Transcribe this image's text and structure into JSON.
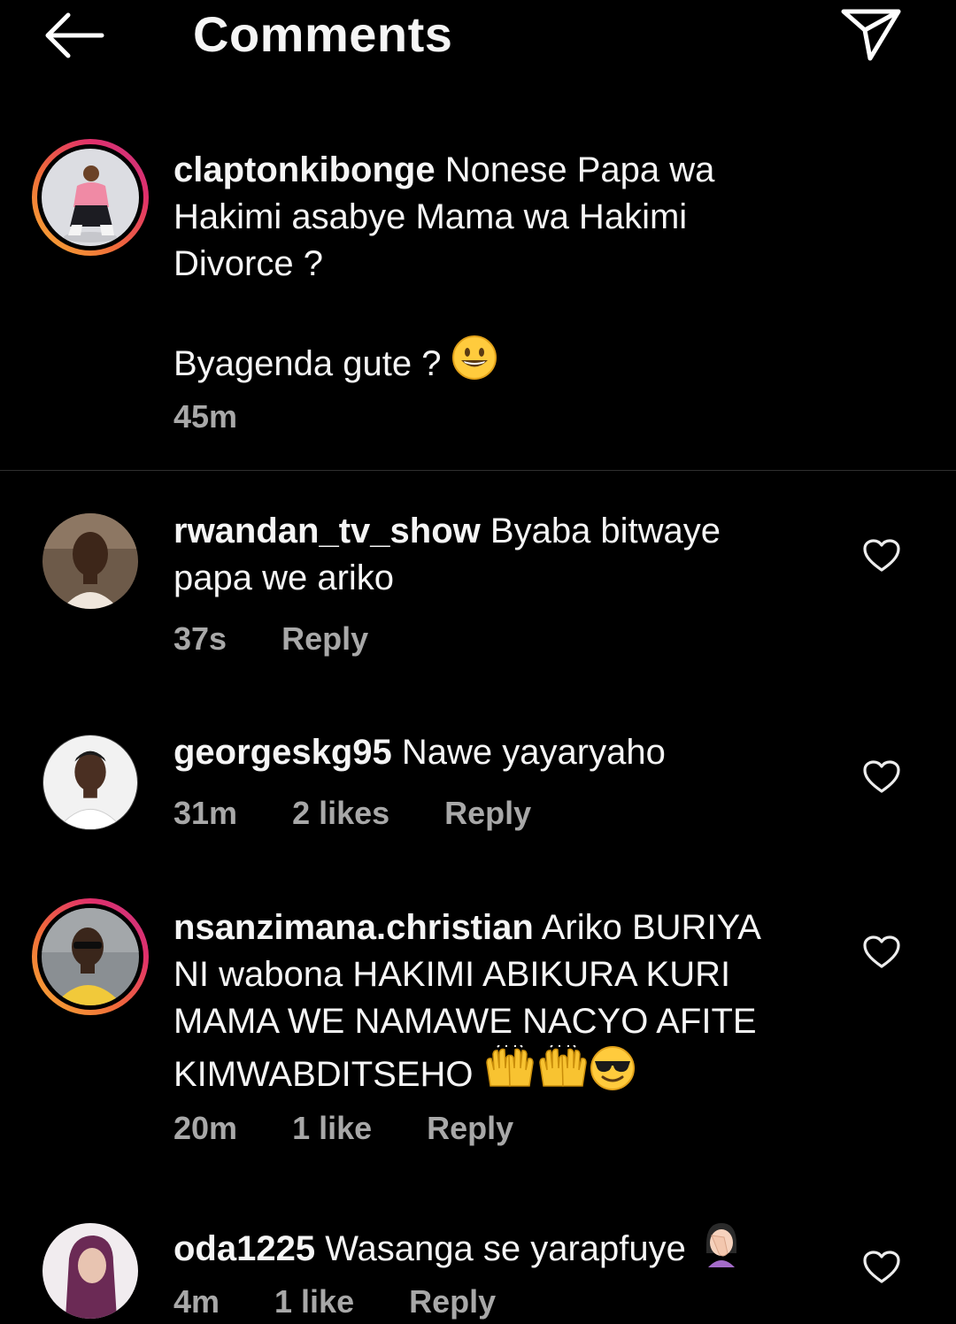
{
  "header": {
    "title": "Comments",
    "back_icon": "arrow-left-icon",
    "send_icon": "paper-plane-icon"
  },
  "caption": {
    "username": "claptonkibonge",
    "text_line1": "Nonese Papa wa",
    "text_line2": "Hakimi asabye Mama wa Hakimi",
    "text_line3": "Divorce ?",
    "text_line4": "Byagenda gute ?",
    "emoji": "grinning-face-emoji",
    "time": "45m"
  },
  "comments": [
    {
      "username": "rwandan_tv_show",
      "text_line1": "Byaba bitwaye",
      "text_line2": "papa we ariko",
      "time": "37s",
      "reply_label": "Reply"
    },
    {
      "username": "georgeskg95",
      "text_line1": "Nawe yayaryaho",
      "time": "31m",
      "likes": "2 likes",
      "reply_label": "Reply"
    },
    {
      "username": "nsanzimana.christian",
      "text_line1": "Ariko BURIYA",
      "text_line2": "NI wabona HAKIMI ABIKURA KURI",
      "text_line3": "MAMA WE NAMAWE NACYO AFITE",
      "text_line4": "KIMWABDITSEHO",
      "emojis": [
        "raising-hands-emoji",
        "raising-hands-emoji",
        "sunglasses-face-emoji"
      ],
      "time": "20m",
      "likes": "1 like",
      "reply_label": "Reply"
    },
    {
      "username": "oda1225",
      "text_line1": "Wasanga se yarapfuye",
      "emoji": "facepalm-emoji",
      "time": "4m",
      "likes": "1 like",
      "reply_label": "Reply"
    }
  ],
  "colors": {
    "background": "#000000",
    "text": "#f5f5f5",
    "meta_text": "#a8a8a8",
    "story_ring_start": "#f9b233",
    "story_ring_end": "#c13584"
  }
}
